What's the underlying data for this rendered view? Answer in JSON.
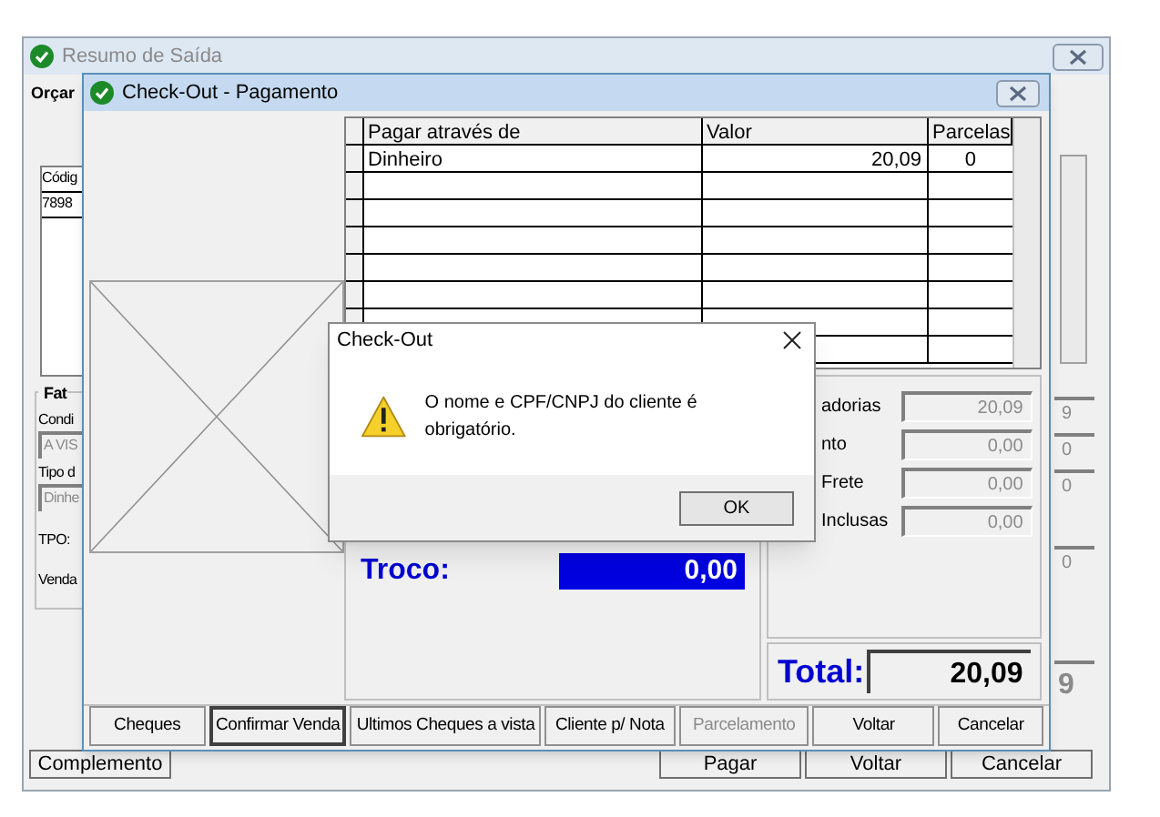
{
  "back_window": {
    "title": "Resumo de Saída",
    "tab": "Orçar",
    "table": {
      "column_1": "Códig",
      "rows": [
        "7898"
      ]
    },
    "group": {
      "title": "Fat",
      "fields": [
        {
          "label": "Condi",
          "value": "A VIS",
          "disabled": true
        },
        {
          "label": "Tipo d",
          "value": "Dinhe",
          "disabled": true
        }
      ],
      "labels": [
        "TPO:",
        "Venda"
      ]
    },
    "right_fields": [
      "9",
      "0",
      "0",
      "0"
    ],
    "total_fragment": "9",
    "buttons": [
      {
        "label": "Complemento"
      },
      {
        "label": "Pagar"
      },
      {
        "label": "Voltar"
      },
      {
        "label": "Cancelar"
      }
    ]
  },
  "checkout_window": {
    "title": "Check-Out - Pagamento",
    "payments": {
      "columns": [
        "Pagar através de",
        "Valor",
        "Parcelas"
      ],
      "rows": [
        {
          "method": "Dinheiro",
          "value": "20,09",
          "installments": "0"
        }
      ]
    },
    "change": {
      "label": "Troco:",
      "value": "0,00"
    },
    "totals": [
      {
        "label": "adorias",
        "value": "20,09",
        "disabled": true
      },
      {
        "label": "nto",
        "value": "0,00",
        "disabled": true
      },
      {
        "label": "Frete",
        "value": "0,00",
        "disabled": true
      },
      {
        "label": "Inclusas",
        "value": "0,00",
        "disabled": true
      }
    ],
    "total": {
      "label": "Total:",
      "value": "20,09"
    },
    "buttons": [
      {
        "label": "Cheques",
        "focused": false,
        "disabled": false
      },
      {
        "label": "Confirmar Venda",
        "focused": true,
        "disabled": false
      },
      {
        "label": "Ultimos Cheques a vista",
        "focused": false,
        "disabled": false
      },
      {
        "label": "Cliente p/ Nota",
        "focused": false,
        "disabled": false
      },
      {
        "label": "Parcelamento",
        "focused": false,
        "disabled": true
      },
      {
        "label": "Voltar",
        "focused": false,
        "disabled": false
      },
      {
        "label": "Cancelar",
        "focused": false,
        "disabled": false
      }
    ]
  },
  "dialog": {
    "title": "Check-Out",
    "message": "O nome e CPF/CNPJ do cliente é obrigatório.",
    "button": "OK"
  }
}
